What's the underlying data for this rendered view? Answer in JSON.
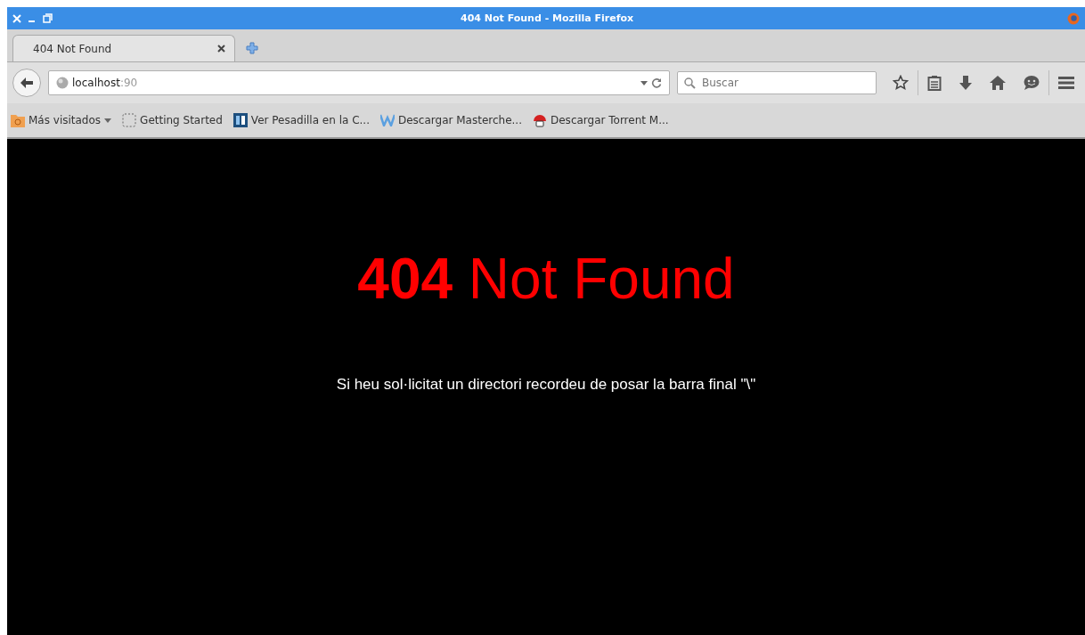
{
  "window": {
    "title": "404 Not Found - Mozilla Firefox"
  },
  "tabs": [
    {
      "label": "404 Not Found",
      "selected": true
    }
  ],
  "address_bar": {
    "host": "localhost",
    "port": ":90"
  },
  "search": {
    "placeholder": "Buscar"
  },
  "bookmarks": [
    {
      "kind": "folder",
      "label": "Más visitados"
    },
    {
      "kind": "page",
      "label": "Getting Started"
    },
    {
      "kind": "sb",
      "label": "Ver Pesadilla en la C..."
    },
    {
      "kind": "w",
      "label": "Descargar Masterche..."
    },
    {
      "kind": "mushroom",
      "label": "Descargar Torrent M..."
    }
  ],
  "page": {
    "heading": "**404** Not Found",
    "message": "Si heu sol·licitat un directori recordeu de posar la barra final \"\\\""
  }
}
